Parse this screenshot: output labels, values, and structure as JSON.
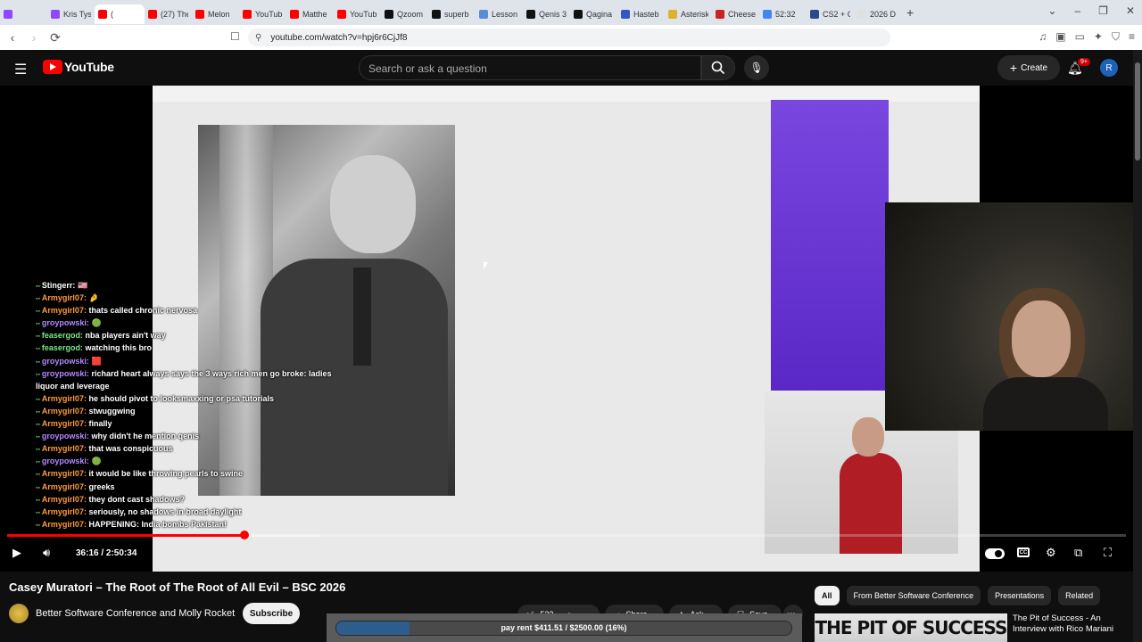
{
  "browser": {
    "tabs": [
      {
        "title": "",
        "color": "#9146ff"
      },
      {
        "title": "Kris Tys",
        "color": "#9146ff"
      },
      {
        "title": "(",
        "color": "#ff0000",
        "active": true
      },
      {
        "title": "(27) The",
        "color": "#ff0000"
      },
      {
        "title": "Melon",
        "color": "#ff0000"
      },
      {
        "title": "YouTub",
        "color": "#ff0000"
      },
      {
        "title": "Matthe",
        "color": "#ff0000"
      },
      {
        "title": "YouTub",
        "color": "#ff0000"
      },
      {
        "title": "Qzoom",
        "color": "#111111"
      },
      {
        "title": "superb",
        "color": "#111111"
      },
      {
        "title": "Lesson",
        "color": "#5b8cd6"
      },
      {
        "title": "Qenis 3",
        "color": "#111111"
      },
      {
        "title": "Qagina",
        "color": "#111111"
      },
      {
        "title": "Hasteb",
        "color": "#3057c8"
      },
      {
        "title": "Asterisk",
        "color": "#e0b030"
      },
      {
        "title": "Cheese",
        "color": "#cc2222"
      },
      {
        "title": "52:32",
        "color": "#4285f4"
      },
      {
        "title": "CS2 + C",
        "color": "#2b4a8a"
      },
      {
        "title": "2026 D",
        "color": "#e0e0e0"
      }
    ],
    "new_tab": "+",
    "url": "youtube.com/watch?v=hpj6r6CjJf8"
  },
  "youtube": {
    "logo_text": "YouTube",
    "search_placeholder": "Search or ask a question",
    "create_label": "Create",
    "notifications_badge": "9+",
    "avatar_letter": "R"
  },
  "chat": [
    {
      "user": "Stingerr:",
      "color": "#ffffff",
      "msg": "🇺🇸"
    },
    {
      "user": "Armygirl07:",
      "color": "#ff9a3c",
      "msg": "🤌"
    },
    {
      "user": "Armygirl07:",
      "color": "#ff9a3c",
      "msg": "thats called chronic nervosa"
    },
    {
      "user": "groypowski:",
      "color": "#b388ff",
      "msg": "🟢"
    },
    {
      "user": "feasergod:",
      "color": "#7ee787",
      "msg": "nba players ain't way"
    },
    {
      "user": "feasergod:",
      "color": "#7ee787",
      "msg": "watching this bro"
    },
    {
      "user": "groypowski:",
      "color": "#b388ff",
      "msg": "🟥"
    },
    {
      "user": "groypowski:",
      "color": "#b388ff",
      "msg": "richard heart always says the 3 ways rich men go broke: ladies"
    },
    {
      "user": "",
      "color": "#ffffff",
      "msg": "liquor and leverage"
    },
    {
      "user": "Armygirl07:",
      "color": "#ff9a3c",
      "msg": "he should pivot to looksmaxxing or psa tutorials"
    },
    {
      "user": "Armygirl07:",
      "color": "#ff9a3c",
      "msg": "stwuggwing"
    },
    {
      "user": "Armygirl07:",
      "color": "#ff9a3c",
      "msg": "finally"
    },
    {
      "user": "groypowski:",
      "color": "#b388ff",
      "msg": "why didn't he mention qenis"
    },
    {
      "user": "Armygirl07:",
      "color": "#ff9a3c",
      "msg": "that was conspicuous"
    },
    {
      "user": "groypowski:",
      "color": "#b388ff",
      "msg": "🟢"
    },
    {
      "user": "Armygirl07:",
      "color": "#ff9a3c",
      "msg": "it would be like throwing pearls to swine"
    },
    {
      "user": "Armygirl07:",
      "color": "#ff9a3c",
      "msg": "greeks"
    },
    {
      "user": "Armygirl07:",
      "color": "#ff9a3c",
      "msg": "they dont cast shadows?"
    },
    {
      "user": "Armygirl07:",
      "color": "#ff9a3c",
      "msg": "seriously, no shadows in broad daylight"
    },
    {
      "user": "Armygirl07:",
      "color": "#ff9a3c",
      "msg": "HAPPENING: India bombs Pakistan!"
    }
  ],
  "player": {
    "time": "36:16 / 2:50:34",
    "progress": 0.2124,
    "buffered": 0.28
  },
  "video": {
    "title": "Casey Muratori – The Root of The Root of All Evil – BSC 2026",
    "channel": "Better Software Conference and Molly Rocket",
    "subscribe": "Subscribe",
    "likes": "523",
    "share": "Share",
    "ask": "Ask",
    "save": "Save",
    "more": "•••"
  },
  "donation": {
    "text": "pay rent $411.51 / $2500.00 (16%)",
    "fraction": 0.16
  },
  "sidebar": {
    "chips": [
      "All",
      "From Better Software Conference",
      "Presentations",
      "Related"
    ],
    "thumb_text": "THE PIT OF SUCCESS",
    "related_title": "The Pit of Success - An Interview with Rico Mariani"
  }
}
